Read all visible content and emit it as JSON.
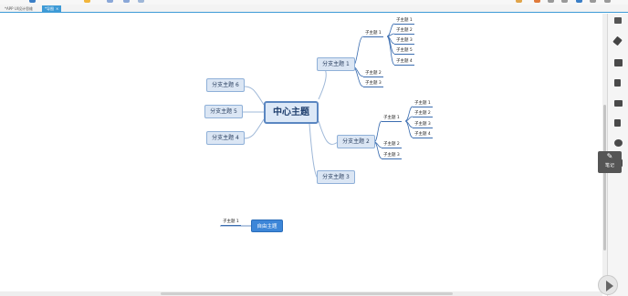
{
  "tabs": [
    {
      "label": "*APP UI设计思维",
      "active": false
    },
    {
      "label": "*导图",
      "active": true,
      "close": "×"
    }
  ],
  "central_topic": "中心主题",
  "branches": {
    "b1": "分支主题 1",
    "b2": "分支主题 2",
    "b3": "分支主题 3",
    "b4": "分支主题 4",
    "b5": "分支主题 5",
    "b6": "分支主题 6"
  },
  "subtopics": {
    "b1_s1": "子主题 1",
    "b1_s2": "子主题 2",
    "b1_s3": "子主题 3",
    "b1_s1_1": "子主题 1",
    "b1_s1_2": "子主题 2",
    "b1_s1_3": "子主题 3",
    "b1_s1_4": "子主题 5",
    "b1_s1_5": "子主题 4",
    "b2_s1": "子主题 1",
    "b2_s2": "子主题 2",
    "b2_s3": "子主题 3",
    "b2_s1_1": "子主题 1",
    "b2_s1_2": "子主题 2",
    "b2_s1_3": "子主题 3",
    "b2_s1_4": "子主题 4"
  },
  "floating": {
    "topic": "自由主题",
    "subtopic": "子主题 1"
  },
  "right_panel": {
    "icons": [
      "outline-icon",
      "brush-icon",
      "image-icon",
      "flag-icon",
      "mail-icon",
      "document-icon",
      "comment-icon",
      "checkbox-icon"
    ],
    "note_label": "笔记"
  },
  "colors": {
    "accent": "#3d9ad6",
    "branch_border": "#8fb0d8",
    "branch_fill": "#dbe6f4",
    "central_border": "#5a86c1",
    "floating_fill": "#3d86d8"
  }
}
